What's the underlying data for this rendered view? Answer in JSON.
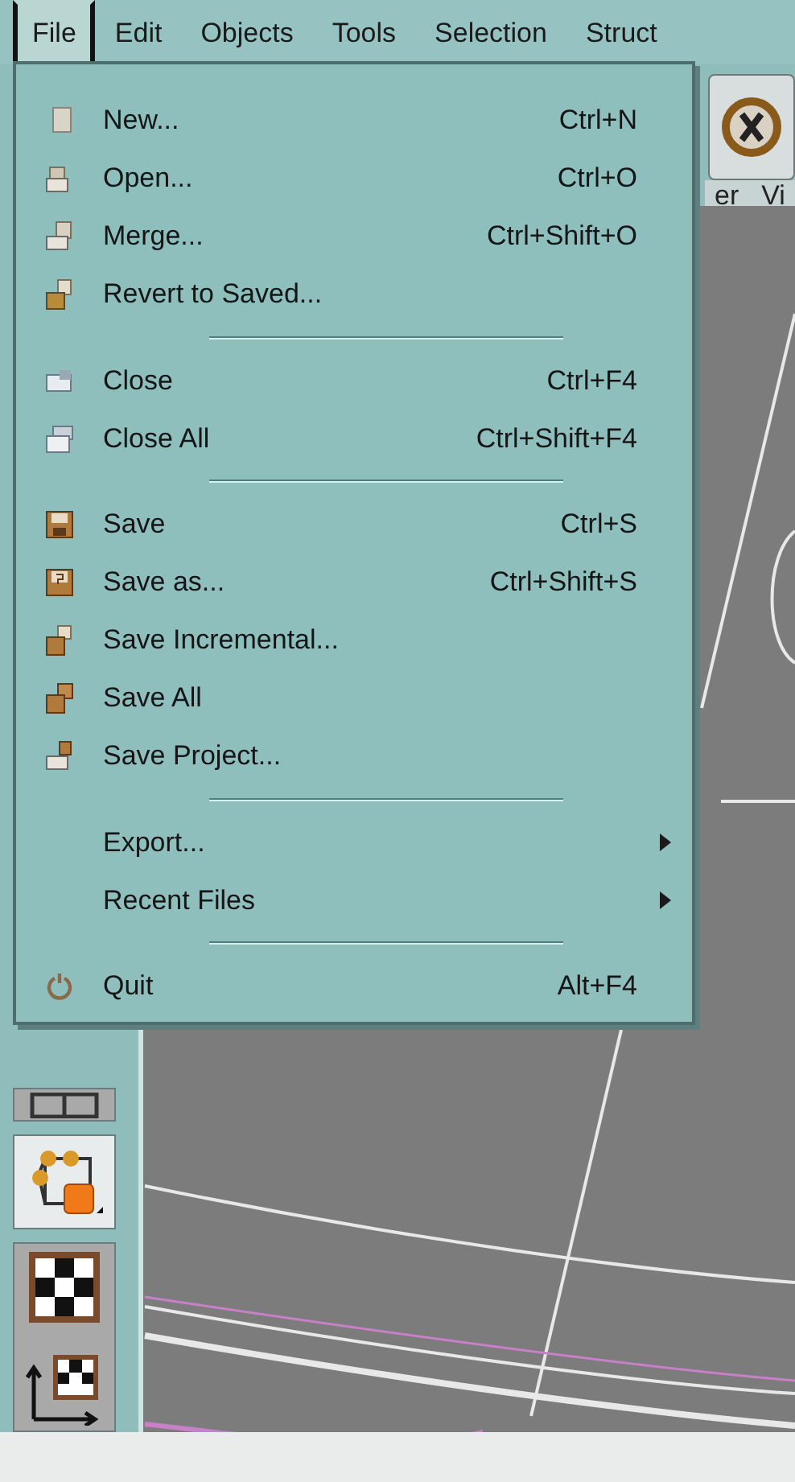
{
  "menubar": [
    {
      "label": "File",
      "selected": true
    },
    {
      "label": "Edit",
      "selected": false
    },
    {
      "label": "Objects",
      "selected": false
    },
    {
      "label": "Tools",
      "selected": false
    },
    {
      "label": "Selection",
      "selected": false
    },
    {
      "label": "Struct",
      "selected": false
    }
  ],
  "file_menu": [
    {
      "kind": "item",
      "label": "New...",
      "shortcut": "Ctrl+N",
      "submenu": false
    },
    {
      "kind": "item",
      "label": "Open...",
      "shortcut": "Ctrl+O",
      "submenu": false
    },
    {
      "kind": "item",
      "label": "Merge...",
      "shortcut": "Ctrl+Shift+O",
      "submenu": false
    },
    {
      "kind": "item",
      "label": "Revert to Saved...",
      "submenu": false
    },
    {
      "kind": "separator"
    },
    {
      "kind": "item",
      "label": "Close",
      "shortcut": "Ctrl+F4",
      "submenu": false
    },
    {
      "kind": "item",
      "label": "Close All",
      "shortcut": "Ctrl+Shift+F4",
      "submenu": false
    },
    {
      "kind": "separator"
    },
    {
      "kind": "item",
      "label": "Save",
      "shortcut": "Ctrl+S",
      "submenu": false
    },
    {
      "kind": "item",
      "label": "Save as...",
      "shortcut": "Ctrl+Shift+S",
      "submenu": false
    },
    {
      "kind": "item",
      "label": "Save Incremental...",
      "submenu": false
    },
    {
      "kind": "item",
      "label": "Save All",
      "submenu": false
    },
    {
      "kind": "item",
      "label": "Save Project...",
      "submenu": false
    },
    {
      "kind": "separator"
    },
    {
      "kind": "item",
      "label": "Export...",
      "submenu": true
    },
    {
      "kind": "item",
      "label": "Recent Files",
      "submenu": true
    },
    {
      "kind": "separator"
    },
    {
      "kind": "item",
      "label": "Quit",
      "shortcut": "Alt+F4",
      "submenu": false
    }
  ],
  "viewport_menu": [
    {
      "label": "er"
    },
    {
      "label": "Vi"
    }
  ]
}
